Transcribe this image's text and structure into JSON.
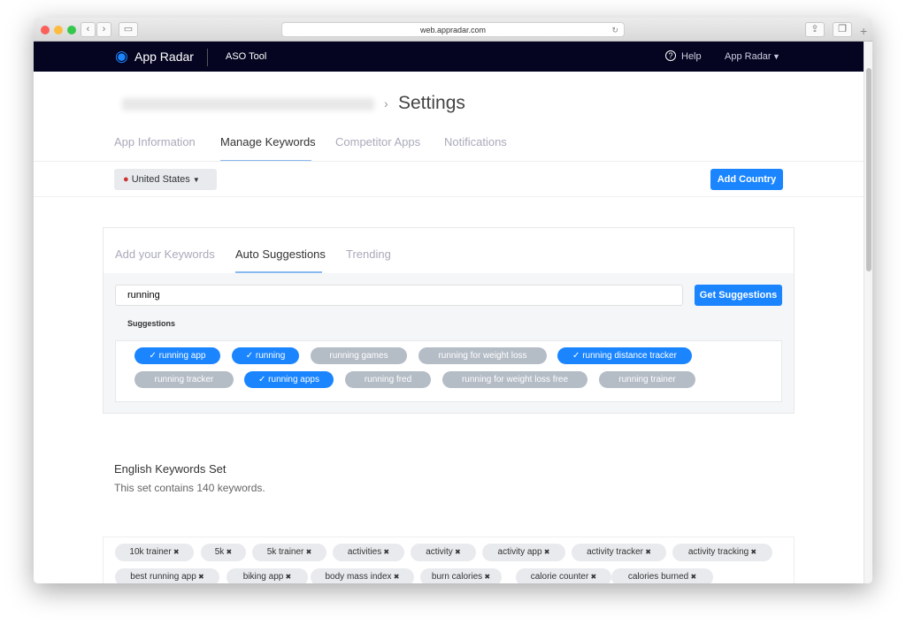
{
  "browser": {
    "url": "web.appradar.com"
  },
  "nav": {
    "brand": "App Radar",
    "product": "ASO Tool",
    "help": "Help",
    "account": "App Radar"
  },
  "page": {
    "title": "Settings",
    "breadcrumb_separator": "›"
  },
  "tabs": [
    {
      "label": "App Information",
      "active": false
    },
    {
      "label": "Manage Keywords",
      "active": true
    },
    {
      "label": "Competitor Apps",
      "active": false
    },
    {
      "label": "Notifications",
      "active": false
    }
  ],
  "country": {
    "selected": "United States",
    "add_label": "Add Country"
  },
  "subtabs": [
    {
      "label": "Add your Keywords",
      "active": false
    },
    {
      "label": "Auto Suggestions",
      "active": true
    },
    {
      "label": "Trending",
      "active": false
    }
  ],
  "search": {
    "value": "running",
    "button": "Get Suggestions"
  },
  "suggestions": {
    "heading": "Suggestions",
    "items": [
      {
        "label": "running app",
        "selected": true
      },
      {
        "label": "running",
        "selected": true
      },
      {
        "label": "running games",
        "selected": false
      },
      {
        "label": "running for weight loss",
        "selected": false
      },
      {
        "label": "running distance tracker",
        "selected": true
      },
      {
        "label": "running tracker",
        "selected": false
      },
      {
        "label": "running apps",
        "selected": true
      },
      {
        "label": "running fred",
        "selected": false
      },
      {
        "label": "running for weight loss free",
        "selected": false
      },
      {
        "label": "running trainer",
        "selected": false
      }
    ]
  },
  "keyword_set": {
    "title": "English Keywords Set",
    "description": "This set contains 140 keywords.",
    "keywords": [
      "10k trainer",
      "5k",
      "5k trainer",
      "activities",
      "activity",
      "activity app",
      "activity tracker",
      "activity tracking",
      "best running app",
      "biking app",
      "body mass index",
      "burn calories",
      "calorie counter",
      "calories burned"
    ]
  },
  "colors": {
    "accent": "#1a85ff",
    "nav_bg": "#050522",
    "chip_off": "#b4bcc6"
  }
}
